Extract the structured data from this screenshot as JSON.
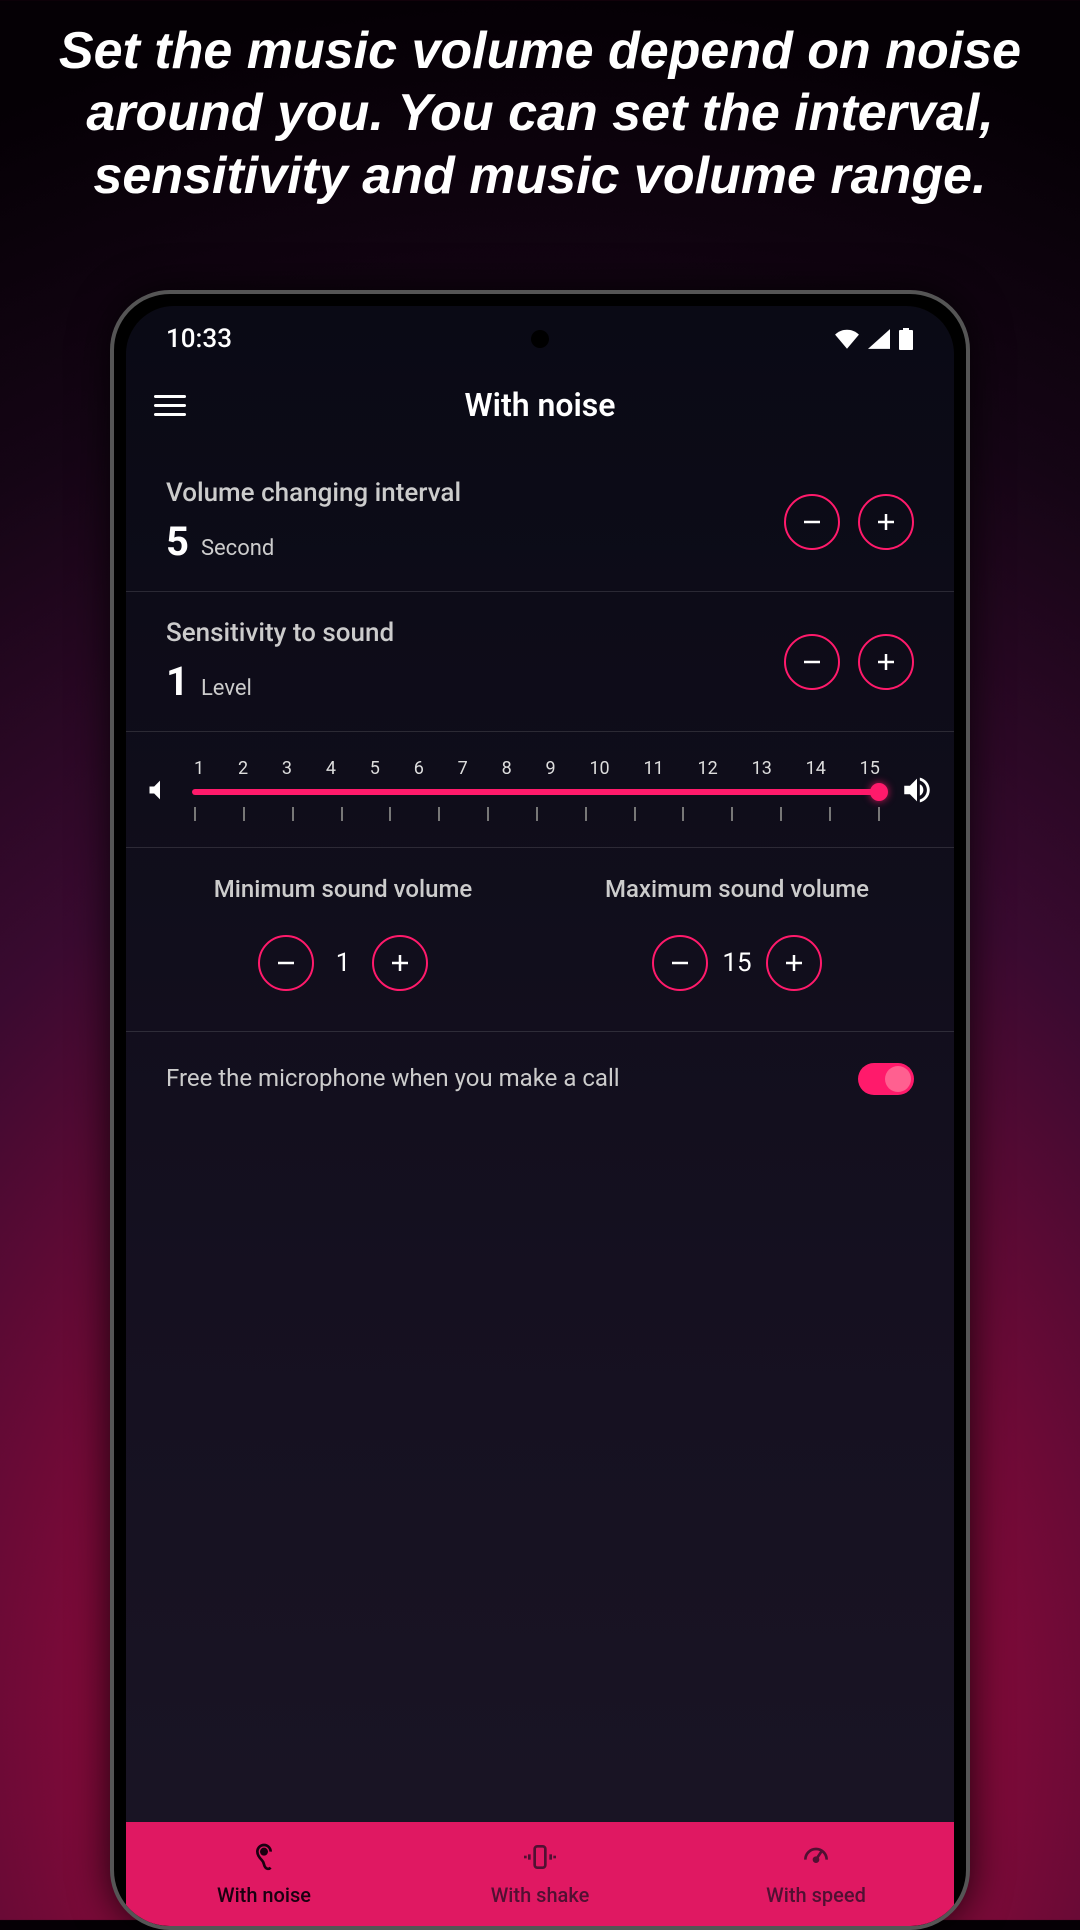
{
  "promo": "Set the music volume depend on noise around you. You can set the interval, sensitivity and music volume range.",
  "statusBar": {
    "time": "10:33"
  },
  "screenTitle": "With noise",
  "interval": {
    "label": "Volume changing interval",
    "value": "5",
    "unit": "Second"
  },
  "sensitivity": {
    "label": "Sensitivity to sound",
    "value": "1",
    "unit": "Level"
  },
  "slider": {
    "labels": [
      "1",
      "2",
      "3",
      "4",
      "5",
      "6",
      "7",
      "8",
      "9",
      "10",
      "11",
      "12",
      "13",
      "14",
      "15"
    ]
  },
  "minSound": {
    "label": "Minimum sound volume",
    "value": "1"
  },
  "maxSound": {
    "label": "Maximum sound volume",
    "value": "15"
  },
  "freeMic": {
    "label": "Free the microphone when you make a call",
    "on": true
  },
  "nav": {
    "noise": "With noise",
    "shake": "With shake",
    "speed": "With speed"
  }
}
